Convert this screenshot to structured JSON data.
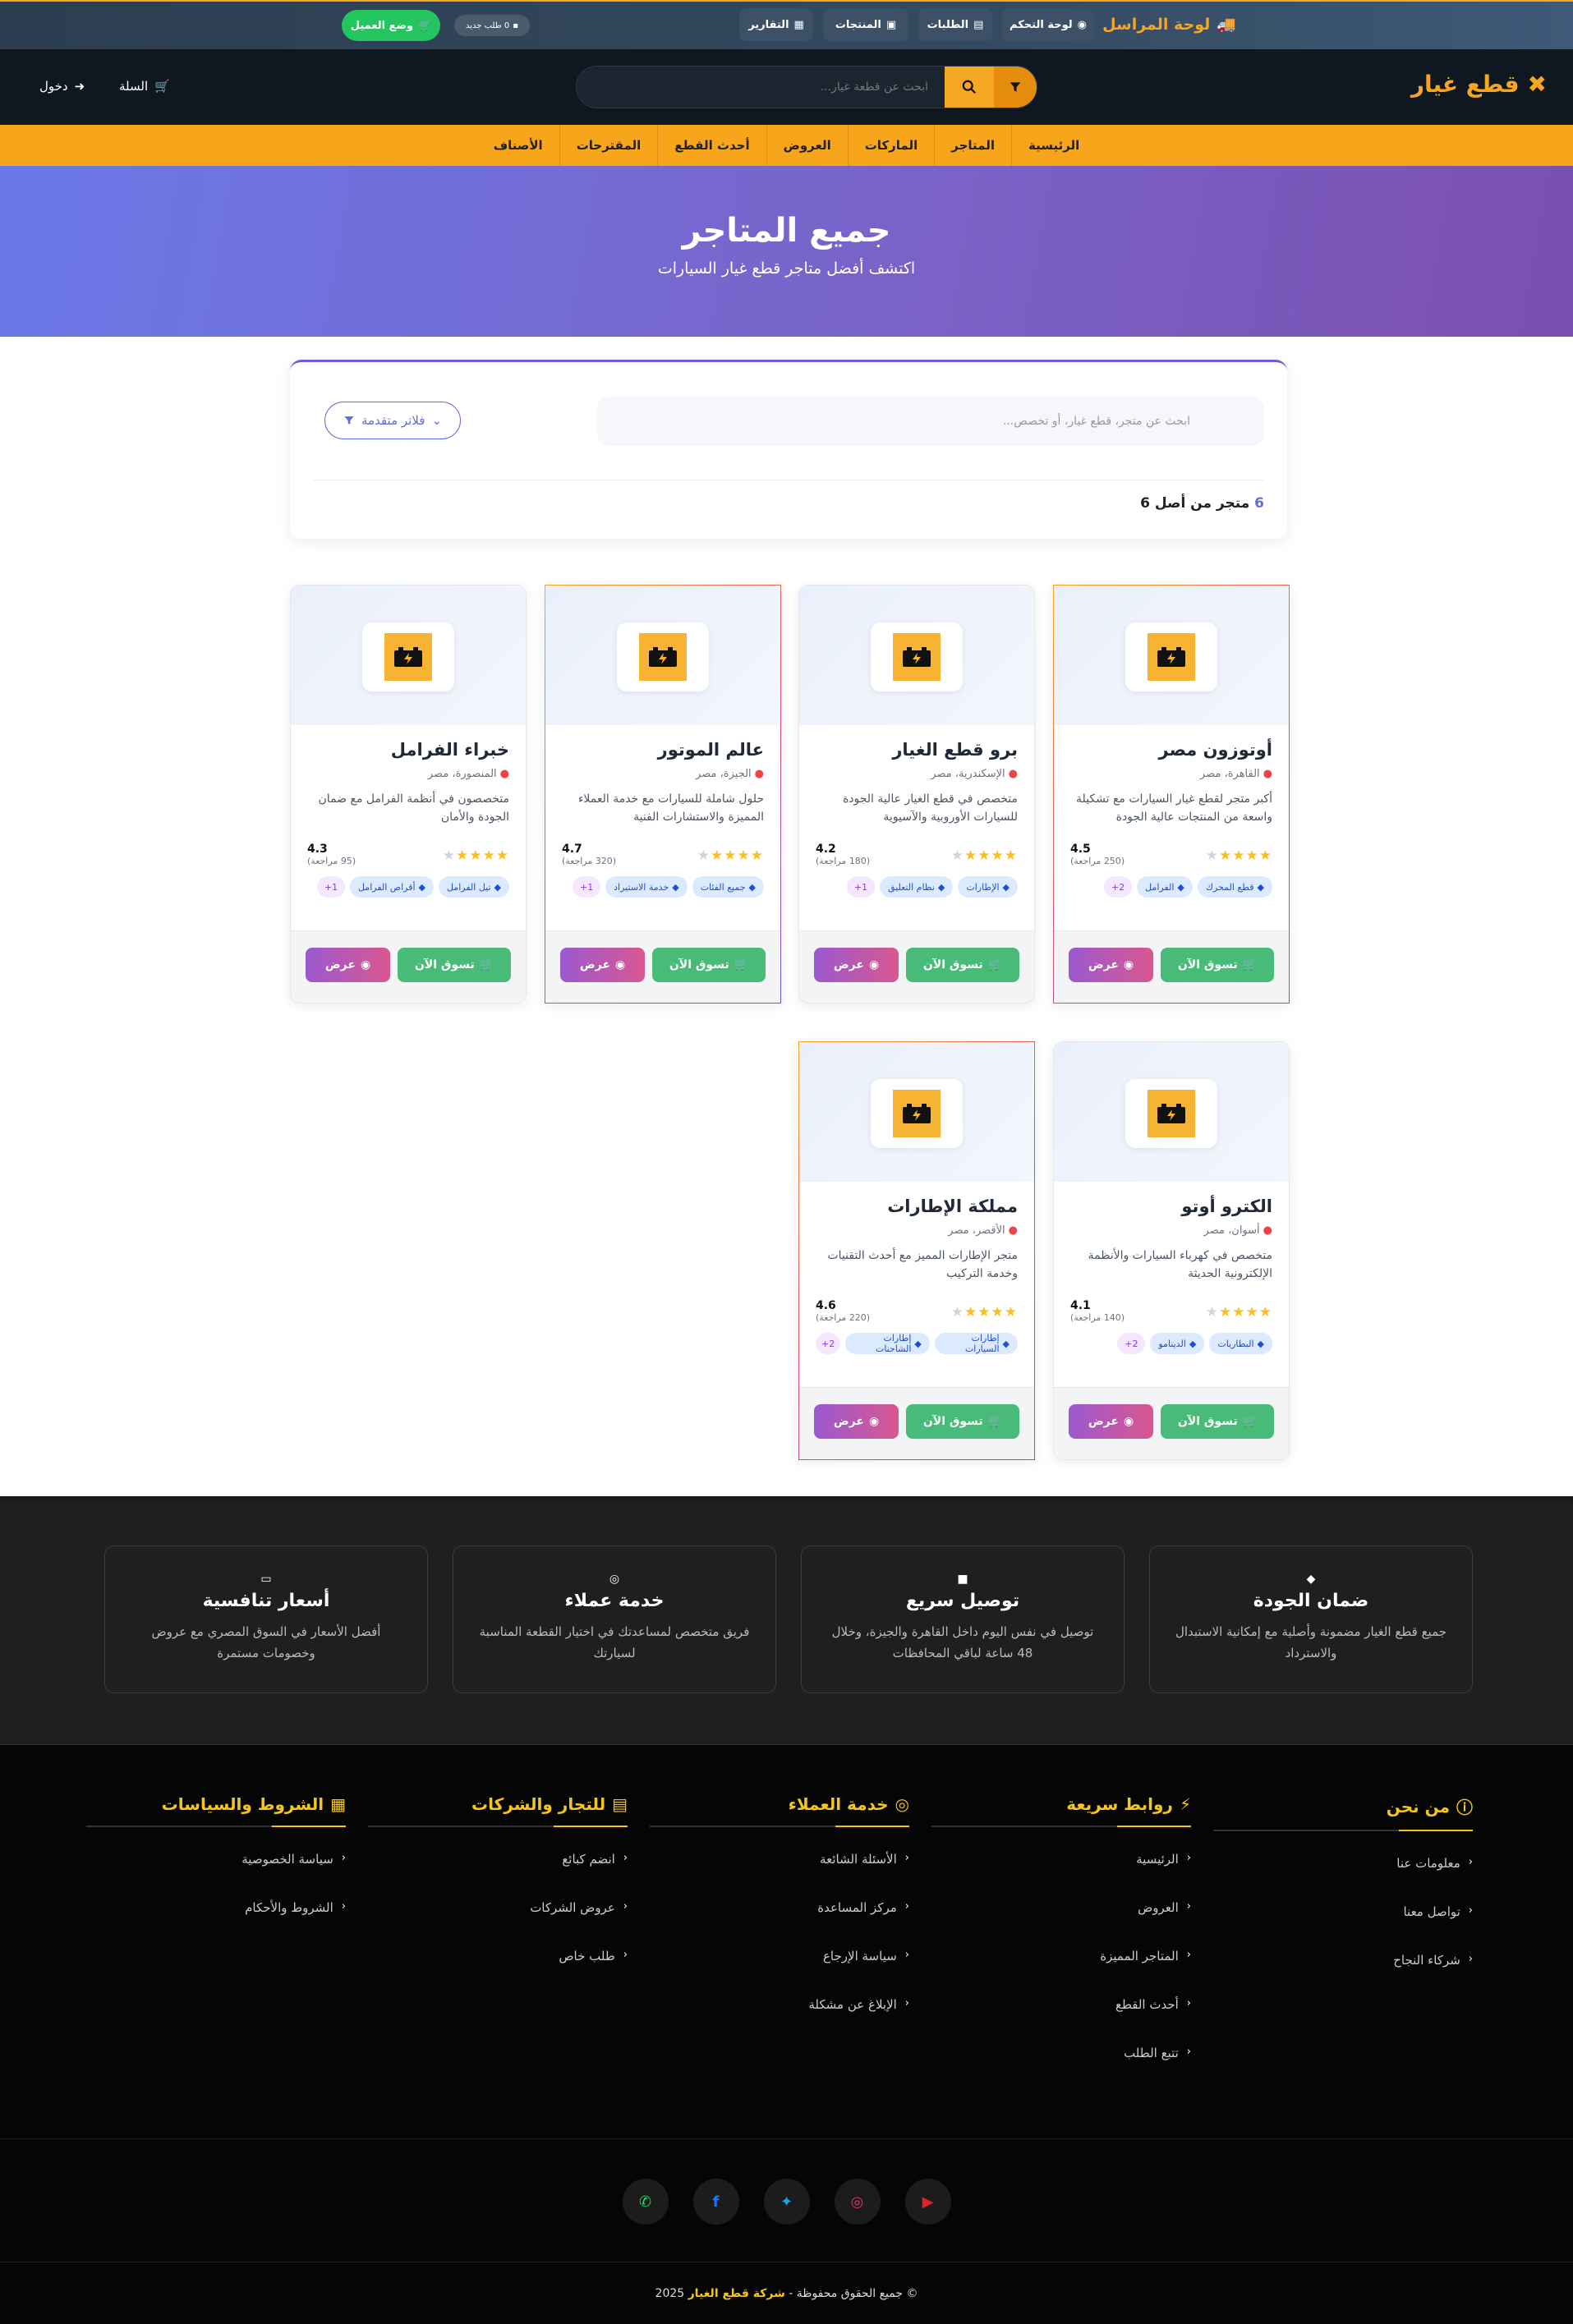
{
  "topbar": {
    "brand": "لوحة المراسل",
    "pills": [
      "لوحة التحكم",
      "الطلبات",
      "المنتجات",
      "التقارير"
    ],
    "new_requests": "0 طلب جديد",
    "work_mode": "وضع العميل"
  },
  "header": {
    "logo": "قطع غيار",
    "search_placeholder": "ابحث عن قطعة غيار...",
    "cart": "السلة",
    "login": "دخول"
  },
  "nav": [
    "الرئيسية",
    "المتاجر",
    "الماركات",
    "العروض",
    "أحدث القطع",
    "المقترحات",
    "الأصناف"
  ],
  "hero": {
    "title": "جميع المتاجر",
    "subtitle": "اكتشف أفضل متاجر قطع غيار السيارات"
  },
  "filters": {
    "search_placeholder": "ابحث عن متجر، قطع غيار، أو تخصص...",
    "advanced": "فلاتر متقدمة",
    "count_num": "6",
    "count_text": "متجر من أصل 6"
  },
  "stores": [
    {
      "name": "أوتوزون مصر",
      "loc": "القاهرة، مصر",
      "desc": "أكبر متجر لقطع غيار السيارات مع تشكيلة واسعة من المنتجات عالية الجودة",
      "rating": "4.5",
      "reviews": "(250 مراجعة)",
      "stars": 4.5,
      "tags": [
        "قطع المحرك",
        "الفرامل"
      ],
      "more": "2+",
      "view": "عرض",
      "shop": "تسوق الآن",
      "featured": true
    },
    {
      "name": "برو قطع الغيار",
      "loc": "الإسكندرية، مصر",
      "desc": "متخصص في قطع الغيار عالية الجودة للسيارات الأوروبية والآسيوية",
      "rating": "4.2",
      "reviews": "(180 مراجعة)",
      "stars": 4.2,
      "tags": [
        "الإطارات",
        "نظام التعليق"
      ],
      "more": "1+",
      "view": "عرض",
      "shop": "تسوق الآن",
      "featured": false
    },
    {
      "name": "عالم الموتور",
      "loc": "الجيزة، مصر",
      "desc": "حلول شاملة للسيارات مع خدمة العملاء المميزة والاستشارات الفنية",
      "rating": "4.7",
      "reviews": "(320 مراجعة)",
      "stars": 4.7,
      "tags": [
        "جميع الفئات",
        "خدمة الاستيراد"
      ],
      "more": "1+",
      "view": "عرض",
      "shop": "تسوق الآن",
      "featured": true
    },
    {
      "name": "خبراء الفرامل",
      "loc": "المنصورة، مصر",
      "desc": "متخصصون في أنظمة الفرامل مع ضمان الجودة والأمان",
      "rating": "4.3",
      "reviews": "(95 مراجعة)",
      "stars": 4.3,
      "tags": [
        "تيل الفرامل",
        "أقراص الفرامل"
      ],
      "more": "1+",
      "view": "عرض",
      "shop": "تسوق الآن",
      "featured": false
    },
    {
      "name": "الكترو أوتو",
      "loc": "أسوان، مصر",
      "desc": "متخصص في كهرباء السيارات والأنظمة الإلكترونية الحديثة",
      "rating": "4.1",
      "reviews": "(140 مراجعة)",
      "stars": 4.1,
      "tags": [
        "البطاريات",
        "الدينامو"
      ],
      "more": "2+",
      "view": "عرض",
      "shop": "تسوق الآن",
      "featured": false
    },
    {
      "name": "مملكة الإطارات",
      "loc": "الأقصر، مصر",
      "desc": "متجر الإطارات المميز مع أحدث التقنيات وخدمة التركيب",
      "rating": "4.6",
      "reviews": "(220 مراجعة)",
      "stars": 4.6,
      "tags": [
        "إطارات السيارات",
        "إطارات الشاحنات"
      ],
      "more": "2+",
      "view": "عرض",
      "shop": "تسوق الآن",
      "featured": true
    }
  ],
  "features": [
    {
      "title": "ضمان الجودة",
      "text": "جميع قطع الغيار مضمونة وأصلية مع إمكانية الاستبدال والاسترداد"
    },
    {
      "title": "توصيل سريع",
      "text": "توصيل في نفس اليوم داخل القاهرة والجيزة، وخلال 48 ساعة لباقي المحافظات"
    },
    {
      "title": "خدمة عملاء",
      "text": "فريق متخصص لمساعدتك في اختيار القطعة المناسبة لسيارتك"
    },
    {
      "title": "أسعار تنافسية",
      "text": "أفضل الأسعار في السوق المصري مع عروض وخصومات مستمرة"
    }
  ],
  "footer": {
    "cols": [
      {
        "title": "من نحن",
        "items": [
          "معلومات عنا",
          "تواصل معنا",
          "شركاء النجاح"
        ]
      },
      {
        "title": "روابط سريعة",
        "items": [
          "الرئيسية",
          "العروض",
          "المتاجر المميزة",
          "أحدث القطع",
          "تتبع الطلب"
        ]
      },
      {
        "title": "خدمة العملاء",
        "items": [
          "الأسئلة الشائعة",
          "مركز المساعدة",
          "سياسة الإرجاع",
          "الإبلاغ عن مشكلة"
        ]
      },
      {
        "title": "للتجار والشركات",
        "items": [
          "انضم كبائع",
          "عروض الشركات",
          "طلب خاص"
        ]
      },
      {
        "title": "الشروط والسياسات",
        "items": [
          "سياسة الخصوصية",
          "الشروط والأحكام"
        ]
      }
    ],
    "copyright_pre": "© جميع الحقوق محفوظة - ",
    "copyright_brand": "شركة قطع الغيار",
    "copyright_year": "2025"
  },
  "colors": {
    "accent": "#f5a623",
    "hero_start": "#6a79e8",
    "hero_end": "#7b4fb0",
    "footer_title": "#f5c518"
  }
}
